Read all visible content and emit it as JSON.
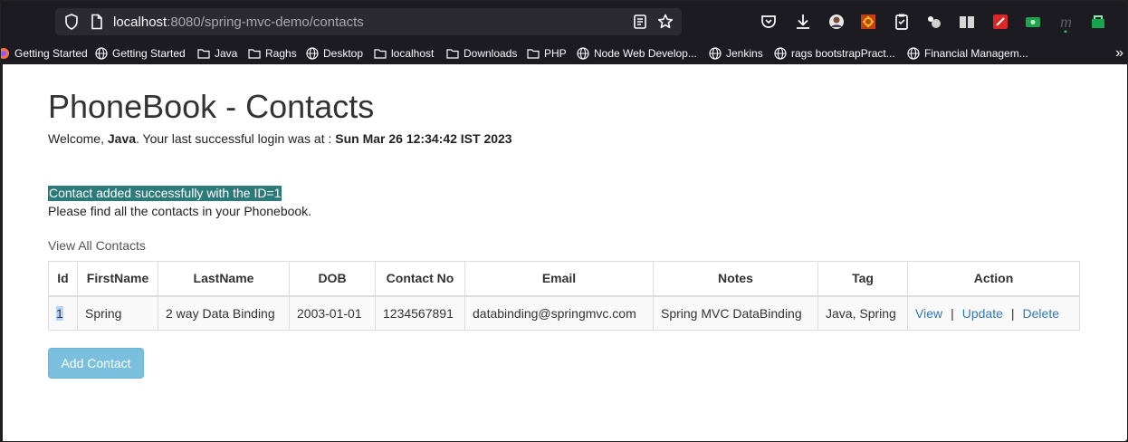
{
  "browser": {
    "url_host": "localhost",
    "url_rest": ":8080/spring-mvc-demo/contacts",
    "bookmarks": [
      {
        "label": "Getting Started",
        "icon": "firefox-icon"
      },
      {
        "label": "Getting Started",
        "icon": "globe-icon"
      },
      {
        "label": "Java",
        "icon": "folder-icon"
      },
      {
        "label": "Raghs",
        "icon": "folder-icon"
      },
      {
        "label": "Desktop",
        "icon": "globe-icon"
      },
      {
        "label": "localhost",
        "icon": "folder-icon"
      },
      {
        "label": "Downloads",
        "icon": "folder-icon"
      },
      {
        "label": "PHP",
        "icon": "folder-icon"
      },
      {
        "label": "Node Web Develop...",
        "icon": "globe-icon"
      },
      {
        "label": "Jenkins",
        "icon": "globe-icon"
      },
      {
        "label": "rags bootstrapPract...",
        "icon": "globe-icon"
      },
      {
        "label": "Financial Managem...",
        "icon": "globe-icon"
      }
    ],
    "more_label": "»"
  },
  "page": {
    "title": "PhoneBook - Contacts",
    "welcome_prefix": "Welcome, ",
    "welcome_user": "Java",
    "welcome_mid": ". Your last successful login was at : ",
    "welcome_time": "Sun Mar 26 12:34:42 IST 2023",
    "success_message": "Contact added successfully with the ID=1",
    "find_message": "Please find all the contacts in your Phonebook.",
    "view_all": "View All Contacts",
    "table": {
      "headers": [
        "Id",
        "FirstName",
        "LastName",
        "DOB",
        "Contact No",
        "Email",
        "Notes",
        "Tag",
        "Action"
      ],
      "rows": [
        {
          "id": "1",
          "first_name": "Spring",
          "last_name": "2 way Data Binding",
          "dob": "2003-01-01",
          "contact_no": "1234567891",
          "email": "databinding@springmvc.com",
          "notes": "Spring MVC DataBinding",
          "tag": "Java, Spring",
          "actions": {
            "view": "View",
            "update": "Update",
            "delete": "Delete",
            "separator": "|"
          }
        }
      ]
    },
    "add_button": "Add Contact"
  },
  "colors": {
    "link": "#337ab7",
    "success_bg": "#2d7a7a",
    "button_bg": "#7ac0de"
  }
}
